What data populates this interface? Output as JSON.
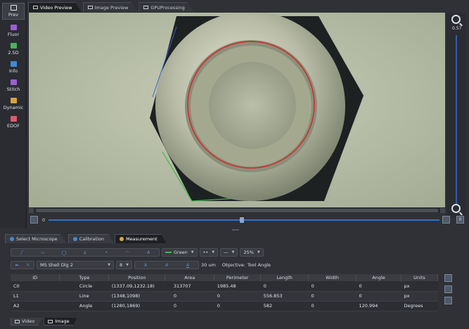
{
  "sidebar": {
    "items": [
      {
        "label": "Prev",
        "color": "#e6e9ee",
        "active": true
      },
      {
        "label": "Fluor",
        "color": "#9b5fd6"
      },
      {
        "label": "2.5D",
        "color": "#47b35a"
      },
      {
        "label": "Info",
        "color": "#3f8ad8"
      },
      {
        "label": "Stitch",
        "color": "#9a5fd0"
      },
      {
        "label": "Dynamic",
        "color": "#d9a23b"
      },
      {
        "label": "EDOF",
        "color": "#e05a6c"
      }
    ]
  },
  "top_tabs": [
    {
      "label": "Video Preview",
      "active": true
    },
    {
      "label": "Image Preview"
    },
    {
      "label": "GPUProcessing"
    }
  ],
  "zoom": {
    "value": "0.57"
  },
  "timeline": {
    "start": "0",
    "right_btn": "0"
  },
  "panel_tabs": [
    {
      "label": "Select Microscope",
      "color": "#3f8ad8"
    },
    {
      "label": "Calibration",
      "color": "#3f8ad8"
    },
    {
      "label": "Measurement",
      "color": "#e0a93b",
      "active": true
    }
  ],
  "toolbar": {
    "line_color": "Green",
    "line_style": "••",
    "line_width": "—",
    "opacity": "25%",
    "scale": "MS Shell Dlg 2",
    "font_size": "8",
    "text_a1": "A",
    "text_a2": "A",
    "text_a3": "A",
    "unit_length": "30 um",
    "objective_label": "Objective:",
    "objective_value": "Tool Angle"
  },
  "table": {
    "headers": [
      "ID",
      "Type",
      "Position",
      "Area",
      "Perimeter",
      "Length",
      "Width",
      "Angle",
      "Units"
    ],
    "rows": [
      [
        "C0",
        "Circle",
        "(1337.09,1232.18)",
        "313707",
        "1985.48",
        "0",
        "0",
        "0",
        "px"
      ],
      [
        "L1",
        "Line",
        "(1348,1098)",
        "0",
        "0",
        "556.853",
        "0",
        "0",
        "px"
      ],
      [
        "A2",
        "Angle",
        "(1280,1869)",
        "0",
        "0",
        "582",
        "0",
        "120.994",
        "Degrees"
      ]
    ]
  },
  "bottom_tabs": [
    {
      "label": "Video"
    },
    {
      "label": "Image",
      "active": true
    }
  ],
  "colors": {
    "accent_blue": "#2f6fc8",
    "measure_red": "#d8262a",
    "measure_green": "#3fb94a"
  }
}
